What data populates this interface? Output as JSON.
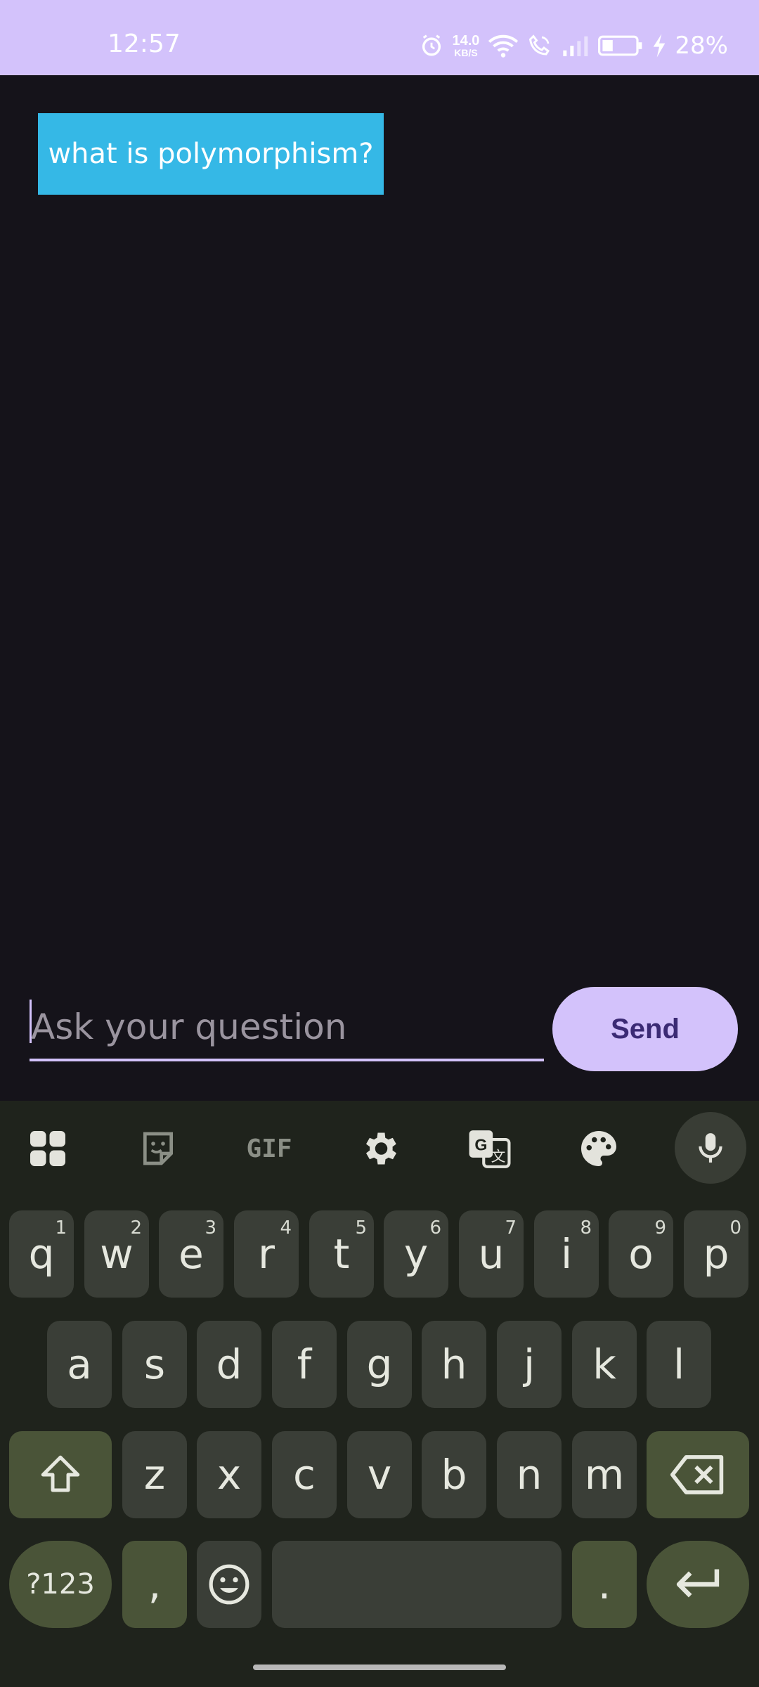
{
  "status_bar": {
    "time": "12:57",
    "net_speed_value": "14.0",
    "net_speed_unit": "KB/S",
    "battery_percent": "28%"
  },
  "chat": {
    "messages": [
      {
        "role": "user",
        "text": "what is polymorphism?"
      }
    ]
  },
  "composer": {
    "placeholder": "Ask your question",
    "send_label": "Send"
  },
  "keyboard": {
    "toolbar_icons": [
      "apps-grid-icon",
      "sticker-icon",
      "gif-icon",
      "settings-gear-icon",
      "translate-icon",
      "palette-icon",
      "microphone-icon"
    ],
    "gif_label": "GIF",
    "row1": [
      {
        "k": "q",
        "h": "1"
      },
      {
        "k": "w",
        "h": "2"
      },
      {
        "k": "e",
        "h": "3"
      },
      {
        "k": "r",
        "h": "4"
      },
      {
        "k": "t",
        "h": "5"
      },
      {
        "k": "y",
        "h": "6"
      },
      {
        "k": "u",
        "h": "7"
      },
      {
        "k": "i",
        "h": "8"
      },
      {
        "k": "o",
        "h": "9"
      },
      {
        "k": "p",
        "h": "0"
      }
    ],
    "row2": [
      "a",
      "s",
      "d",
      "f",
      "g",
      "h",
      "j",
      "k",
      "l"
    ],
    "row3": [
      "z",
      "x",
      "c",
      "v",
      "b",
      "n",
      "m"
    ],
    "symbols_label": "?123",
    "comma_label": ",",
    "period_label": "."
  },
  "colors": {
    "accent": "#d3c2fb",
    "bubble": "#35b8e6",
    "background": "#15131a",
    "keyboard_bg": "#1f231c"
  }
}
